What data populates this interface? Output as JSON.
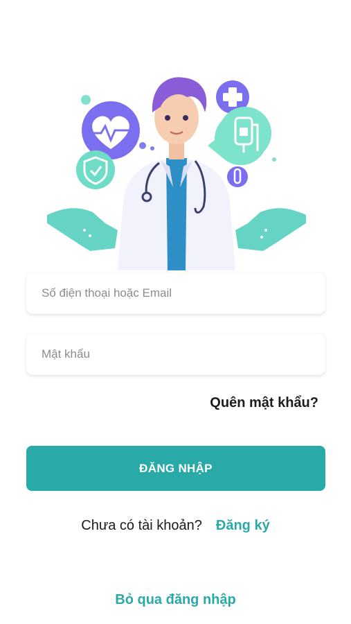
{
  "login": {
    "username_placeholder": "Số điện thoại hoặc Email",
    "password_placeholder": "Mật khẩu",
    "forgot_password": "Quên mật khẩu?",
    "login_button": "ĐĂNG NHẬP",
    "no_account_text": "Chưa có tài khoản?",
    "signup_link": "Đăng ký",
    "skip_login": "Bỏ qua đăng nhập"
  },
  "colors": {
    "accent": "#29aaa8",
    "text_dark": "#1b1b1b",
    "placeholder": "#8c8c8c"
  },
  "illustration": {
    "icons": [
      "heart-pulse-icon",
      "shield-check-icon",
      "medical-cross-icon",
      "iv-bag-icon",
      "test-tube-icon"
    ]
  }
}
